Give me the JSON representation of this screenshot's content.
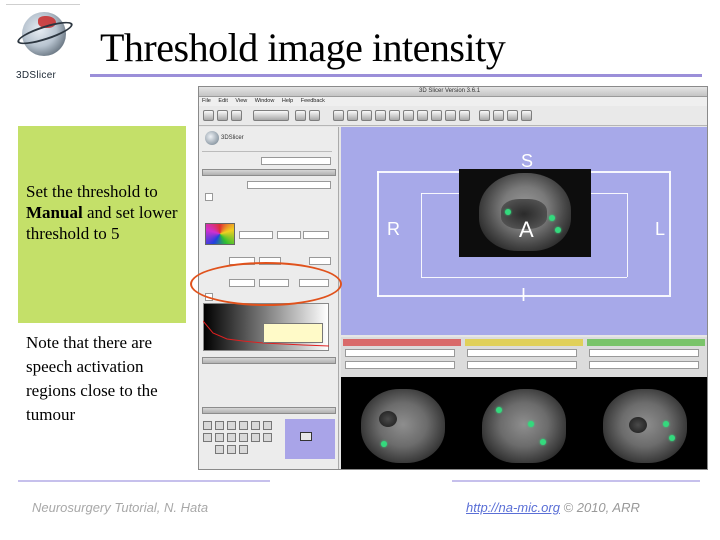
{
  "slide": {
    "title": "Threshold image intensity",
    "logo_text": "3DSlicer",
    "note_1_prefix": "Set the threshold to ",
    "note_1_bold": "Manual",
    "note_1_suffix": " and set lower threshold to 5",
    "note_2": "Note that there are speech activation regions close to the tumour",
    "footer_left": "Neurosurgery Tutorial, N. Hata",
    "footer_link": "http://na-mic.org",
    "footer_right_suffix": " © 2010, ARR"
  },
  "slicer": {
    "window_title": "3D Slicer Version 3.6.1",
    "menu": [
      "File",
      "Edit",
      "View",
      "Window",
      "Help",
      "Feedback"
    ],
    "logo_text": "3DSlicer",
    "view3d_labels": {
      "superior": "S",
      "right": "R",
      "anterior": "A",
      "left": "L",
      "inferior": "I"
    }
  },
  "colors": {
    "title_rule": "#9b8fd9",
    "note_box": "#c4e069",
    "view3d_bg": "#a7a9e9",
    "highlight_ellipse": "#e0521c",
    "activation": "#34d97d"
  }
}
